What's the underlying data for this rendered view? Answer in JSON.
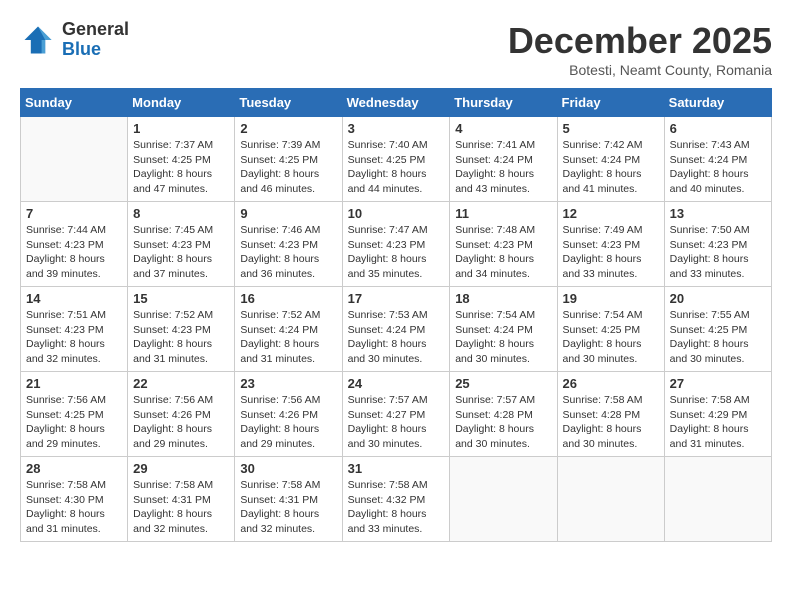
{
  "logo": {
    "general": "General",
    "blue": "Blue"
  },
  "title": "December 2025",
  "subtitle": "Botesti, Neamt County, Romania",
  "days_of_week": [
    "Sunday",
    "Monday",
    "Tuesday",
    "Wednesday",
    "Thursday",
    "Friday",
    "Saturday"
  ],
  "weeks": [
    [
      {
        "day": "",
        "info": ""
      },
      {
        "day": "1",
        "info": "Sunrise: 7:37 AM\nSunset: 4:25 PM\nDaylight: 8 hours\nand 47 minutes."
      },
      {
        "day": "2",
        "info": "Sunrise: 7:39 AM\nSunset: 4:25 PM\nDaylight: 8 hours\nand 46 minutes."
      },
      {
        "day": "3",
        "info": "Sunrise: 7:40 AM\nSunset: 4:25 PM\nDaylight: 8 hours\nand 44 minutes."
      },
      {
        "day": "4",
        "info": "Sunrise: 7:41 AM\nSunset: 4:24 PM\nDaylight: 8 hours\nand 43 minutes."
      },
      {
        "day": "5",
        "info": "Sunrise: 7:42 AM\nSunset: 4:24 PM\nDaylight: 8 hours\nand 41 minutes."
      },
      {
        "day": "6",
        "info": "Sunrise: 7:43 AM\nSunset: 4:24 PM\nDaylight: 8 hours\nand 40 minutes."
      }
    ],
    [
      {
        "day": "7",
        "info": "Sunrise: 7:44 AM\nSunset: 4:23 PM\nDaylight: 8 hours\nand 39 minutes."
      },
      {
        "day": "8",
        "info": "Sunrise: 7:45 AM\nSunset: 4:23 PM\nDaylight: 8 hours\nand 37 minutes."
      },
      {
        "day": "9",
        "info": "Sunrise: 7:46 AM\nSunset: 4:23 PM\nDaylight: 8 hours\nand 36 minutes."
      },
      {
        "day": "10",
        "info": "Sunrise: 7:47 AM\nSunset: 4:23 PM\nDaylight: 8 hours\nand 35 minutes."
      },
      {
        "day": "11",
        "info": "Sunrise: 7:48 AM\nSunset: 4:23 PM\nDaylight: 8 hours\nand 34 minutes."
      },
      {
        "day": "12",
        "info": "Sunrise: 7:49 AM\nSunset: 4:23 PM\nDaylight: 8 hours\nand 33 minutes."
      },
      {
        "day": "13",
        "info": "Sunrise: 7:50 AM\nSunset: 4:23 PM\nDaylight: 8 hours\nand 33 minutes."
      }
    ],
    [
      {
        "day": "14",
        "info": "Sunrise: 7:51 AM\nSunset: 4:23 PM\nDaylight: 8 hours\nand 32 minutes."
      },
      {
        "day": "15",
        "info": "Sunrise: 7:52 AM\nSunset: 4:23 PM\nDaylight: 8 hours\nand 31 minutes."
      },
      {
        "day": "16",
        "info": "Sunrise: 7:52 AM\nSunset: 4:24 PM\nDaylight: 8 hours\nand 31 minutes."
      },
      {
        "day": "17",
        "info": "Sunrise: 7:53 AM\nSunset: 4:24 PM\nDaylight: 8 hours\nand 30 minutes."
      },
      {
        "day": "18",
        "info": "Sunrise: 7:54 AM\nSunset: 4:24 PM\nDaylight: 8 hours\nand 30 minutes."
      },
      {
        "day": "19",
        "info": "Sunrise: 7:54 AM\nSunset: 4:25 PM\nDaylight: 8 hours\nand 30 minutes."
      },
      {
        "day": "20",
        "info": "Sunrise: 7:55 AM\nSunset: 4:25 PM\nDaylight: 8 hours\nand 30 minutes."
      }
    ],
    [
      {
        "day": "21",
        "info": "Sunrise: 7:56 AM\nSunset: 4:25 PM\nDaylight: 8 hours\nand 29 minutes."
      },
      {
        "day": "22",
        "info": "Sunrise: 7:56 AM\nSunset: 4:26 PM\nDaylight: 8 hours\nand 29 minutes."
      },
      {
        "day": "23",
        "info": "Sunrise: 7:56 AM\nSunset: 4:26 PM\nDaylight: 8 hours\nand 29 minutes."
      },
      {
        "day": "24",
        "info": "Sunrise: 7:57 AM\nSunset: 4:27 PM\nDaylight: 8 hours\nand 30 minutes."
      },
      {
        "day": "25",
        "info": "Sunrise: 7:57 AM\nSunset: 4:28 PM\nDaylight: 8 hours\nand 30 minutes."
      },
      {
        "day": "26",
        "info": "Sunrise: 7:58 AM\nSunset: 4:28 PM\nDaylight: 8 hours\nand 30 minutes."
      },
      {
        "day": "27",
        "info": "Sunrise: 7:58 AM\nSunset: 4:29 PM\nDaylight: 8 hours\nand 31 minutes."
      }
    ],
    [
      {
        "day": "28",
        "info": "Sunrise: 7:58 AM\nSunset: 4:30 PM\nDaylight: 8 hours\nand 31 minutes."
      },
      {
        "day": "29",
        "info": "Sunrise: 7:58 AM\nSunset: 4:31 PM\nDaylight: 8 hours\nand 32 minutes."
      },
      {
        "day": "30",
        "info": "Sunrise: 7:58 AM\nSunset: 4:31 PM\nDaylight: 8 hours\nand 32 minutes."
      },
      {
        "day": "31",
        "info": "Sunrise: 7:58 AM\nSunset: 4:32 PM\nDaylight: 8 hours\nand 33 minutes."
      },
      {
        "day": "",
        "info": ""
      },
      {
        "day": "",
        "info": ""
      },
      {
        "day": "",
        "info": ""
      }
    ]
  ]
}
